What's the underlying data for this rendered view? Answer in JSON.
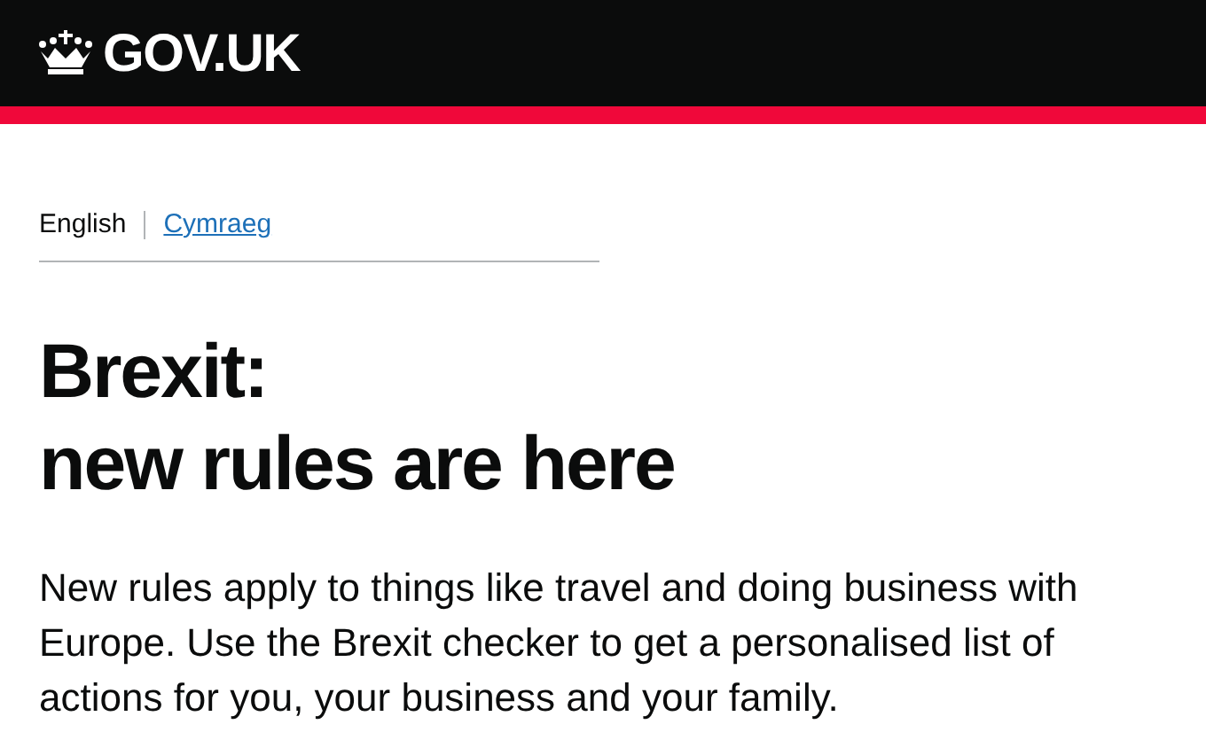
{
  "header": {
    "logo_text": "GOV.UK"
  },
  "languages": [
    {
      "label": "English",
      "selected": true
    },
    {
      "label": "Cymraeg",
      "selected": false
    }
  ],
  "heading": [
    "Brexit:",
    "new rules are here"
  ],
  "intro": "New rules apply to things like travel and doing business with Europe. Use the Brexit checker to get a personalised list of actions for you, your business and your family."
}
